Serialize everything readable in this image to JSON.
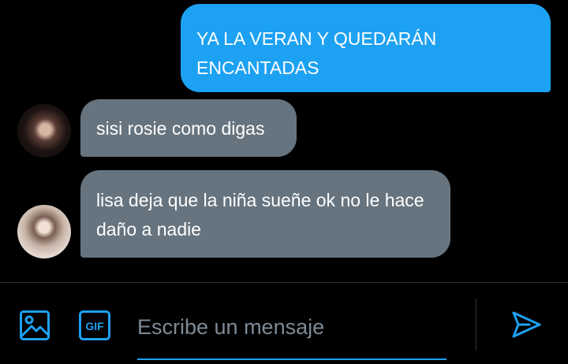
{
  "conversation": {
    "messages": [
      {
        "direction": "sent",
        "text": "YA LA VERAN Y QUEDARÁN ENCANTADAS"
      },
      {
        "direction": "received",
        "text": "sisi rosie como digas"
      },
      {
        "direction": "received",
        "text": "lisa deja que la niña sueñe ok no le hace daño a nadie"
      }
    ]
  },
  "composer": {
    "placeholder": "Escribe un mensaje",
    "gif_label": "GIF",
    "image_icon": "image-icon",
    "send_icon": "send-icon"
  },
  "colors": {
    "background": "#000000",
    "sent_bubble": "#1da1f2",
    "received_bubble": "#66747f",
    "accent": "#1da1f2",
    "placeholder": "#7d8a96"
  }
}
